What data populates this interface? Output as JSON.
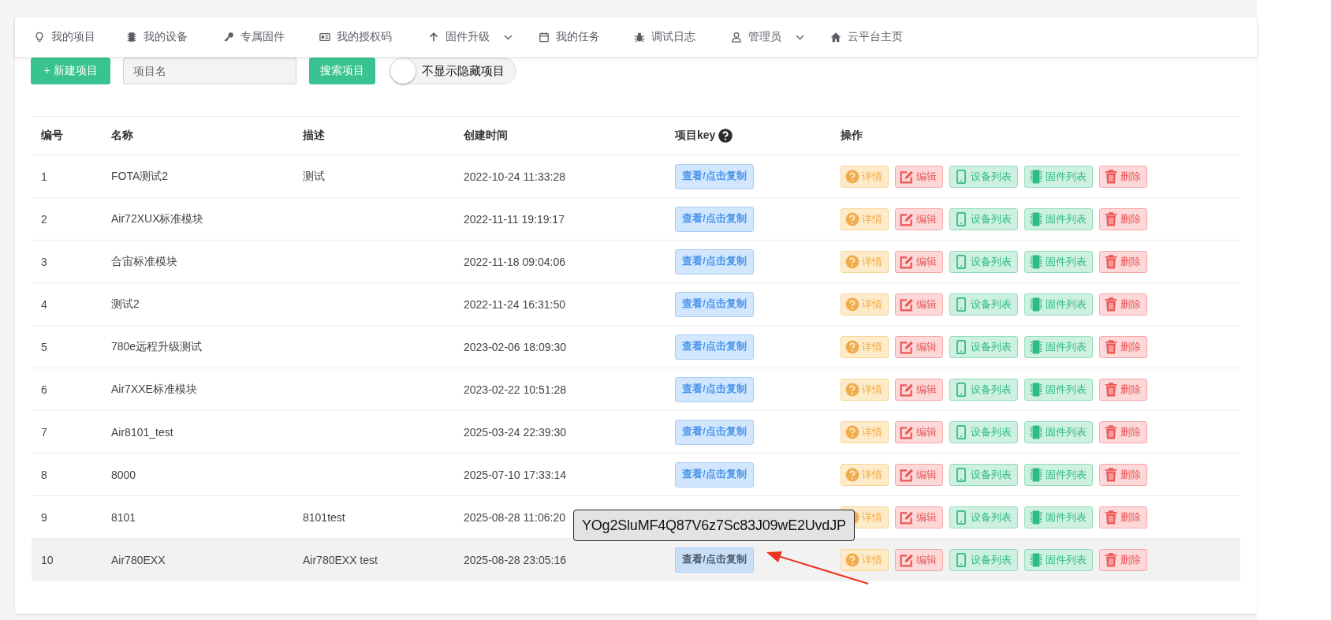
{
  "nav": {
    "items": [
      {
        "label": "我的项目",
        "dropdown": false
      },
      {
        "label": "我的设备",
        "dropdown": false
      },
      {
        "label": "专属固件",
        "dropdown": false
      },
      {
        "label": "我的授权码",
        "dropdown": false
      },
      {
        "label": "固件升级",
        "dropdown": true
      },
      {
        "label": "我的任务",
        "dropdown": false
      },
      {
        "label": "调试日志",
        "dropdown": false
      },
      {
        "label": "管理员",
        "dropdown": true
      },
      {
        "label": "云平台主页",
        "dropdown": false
      }
    ]
  },
  "toolbar": {
    "new_button": "+ 新建项目",
    "search_field": {
      "placeholder": "项目名"
    },
    "search_button": "搜索项目",
    "toggle": {
      "label": "不显示隐藏项目",
      "on": false
    }
  },
  "table": {
    "columns": [
      "编号",
      "名称",
      "描述",
      "创建时间",
      "项目key",
      "操作"
    ],
    "rows": [
      {
        "id": "1",
        "name": "FOTA测试2",
        "description": "测试",
        "created": "2022-10-24 11:33:28",
        "key_button": "查看/点击复制",
        "highlighted": false,
        "actions": [
          {
            "kind": "detail",
            "label": "详情"
          },
          {
            "kind": "edit",
            "label": "编辑"
          },
          {
            "kind": "devices",
            "label": "设备列表"
          },
          {
            "kind": "firmware",
            "label": "固件列表"
          },
          {
            "kind": "delete",
            "label": "删除"
          }
        ]
      },
      {
        "id": "2",
        "name": "Air72XUX标准模块",
        "created": "2022-11-11 19:19:17",
        "key_button": "查看/点击复制",
        "highlighted": false,
        "actions": [
          {
            "kind": "detail",
            "label": "详情"
          },
          {
            "kind": "edit",
            "label": "编辑"
          },
          {
            "kind": "devices",
            "label": "设备列表"
          },
          {
            "kind": "firmware",
            "label": "固件列表"
          },
          {
            "kind": "delete",
            "label": "删除"
          }
        ]
      },
      {
        "id": "3",
        "name": "合宙标准模块",
        "created": "2022-11-18 09:04:06",
        "key_button": "查看/点击复制",
        "highlighted": false,
        "actions": [
          {
            "kind": "detail",
            "label": "详情"
          },
          {
            "kind": "edit",
            "label": "编辑"
          },
          {
            "kind": "devices",
            "label": "设备列表"
          },
          {
            "kind": "firmware",
            "label": "固件列表"
          },
          {
            "kind": "delete",
            "label": "删除"
          }
        ]
      },
      {
        "id": "4",
        "name": "测试2",
        "created": "2022-11-24 16:31:50",
        "key_button": "查看/点击复制",
        "highlighted": false,
        "actions": [
          {
            "kind": "detail",
            "label": "详情"
          },
          {
            "kind": "edit",
            "label": "编辑"
          },
          {
            "kind": "devices",
            "label": "设备列表"
          },
          {
            "kind": "firmware",
            "label": "固件列表"
          },
          {
            "kind": "delete",
            "label": "删除"
          }
        ]
      },
      {
        "id": "5",
        "name": "780e远程升级测试",
        "created": "2023-02-06 18:09:30",
        "key_button": "查看/点击复制",
        "highlighted": false,
        "actions": [
          {
            "kind": "detail",
            "label": "详情"
          },
          {
            "kind": "edit",
            "label": "编辑"
          },
          {
            "kind": "devices",
            "label": "设备列表"
          },
          {
            "kind": "firmware",
            "label": "固件列表"
          },
          {
            "kind": "delete",
            "label": "删除"
          }
        ]
      },
      {
        "id": "6",
        "name": "Air7XXE标准模块",
        "created": "2023-02-22 10:51:28",
        "key_button": "查看/点击复制",
        "highlighted": false,
        "actions": [
          {
            "kind": "detail",
            "label": "详情"
          },
          {
            "kind": "edit",
            "label": "编辑"
          },
          {
            "kind": "devices",
            "label": "设备列表"
          },
          {
            "kind": "firmware",
            "label": "固件列表"
          },
          {
            "kind": "delete",
            "label": "删除"
          }
        ]
      },
      {
        "id": "7",
        "name": "Air8101_test",
        "created": "2025-03-24 22:39:30",
        "key_button": "查看/点击复制",
        "highlighted": false,
        "actions": [
          {
            "kind": "detail",
            "label": "详情"
          },
          {
            "kind": "edit",
            "label": "编辑"
          },
          {
            "kind": "devices",
            "label": "设备列表"
          },
          {
            "kind": "firmware",
            "label": "固件列表"
          },
          {
            "kind": "delete",
            "label": "删除"
          }
        ]
      },
      {
        "id": "8",
        "name": "8000",
        "created": "2025-07-10 17:33:14",
        "key_button": "查看/点击复制",
        "highlighted": false,
        "actions": [
          {
            "kind": "detail",
            "label": "详情"
          },
          {
            "kind": "edit",
            "label": "编辑"
          },
          {
            "kind": "devices",
            "label": "设备列表"
          },
          {
            "kind": "firmware",
            "label": "固件列表"
          },
          {
            "kind": "delete",
            "label": "删除"
          }
        ]
      },
      {
        "id": "9",
        "name": "8101",
        "description": "8101test",
        "created": "2025-08-28 11:06:20",
        "highlighted": false,
        "actions": [
          {
            "kind": "detail",
            "label": "详情"
          },
          {
            "kind": "edit",
            "label": "编辑"
          },
          {
            "kind": "devices",
            "label": "设备列表"
          },
          {
            "kind": "firmware",
            "label": "固件列表"
          },
          {
            "kind": "delete",
            "label": "删除"
          }
        ]
      },
      {
        "id": "10",
        "name": "Air780EXX",
        "description": "Air780EXX test",
        "created": "2025-08-28 23:05:16",
        "key_button": "查看/点击复制",
        "highlighted": true,
        "actions": [
          {
            "kind": "detail",
            "label": "详情"
          },
          {
            "kind": "edit",
            "label": "编辑"
          },
          {
            "kind": "devices",
            "label": "设备列表"
          },
          {
            "kind": "firmware",
            "label": "固件列表"
          },
          {
            "kind": "delete",
            "label": "删除"
          }
        ]
      }
    ]
  },
  "tooltip": {
    "text": "YOg2SluMF4Q87V6z7Sc83J09wE2UvdJP"
  }
}
